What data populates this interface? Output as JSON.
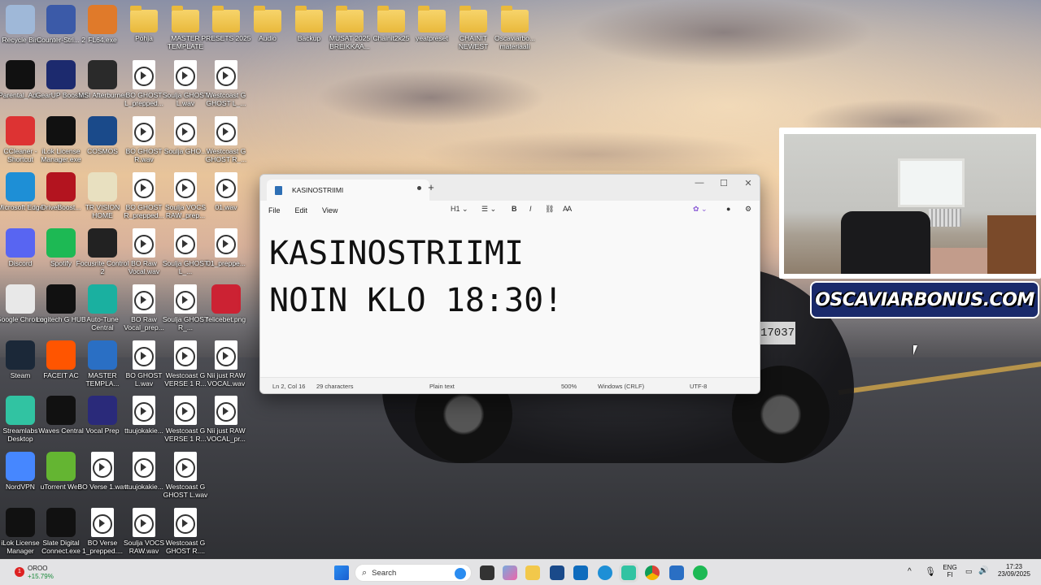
{
  "desktop_icons": [
    {
      "label": "Recycle Bin",
      "icon": "recycle-bin-icon",
      "color": "#9fb8d8"
    },
    {
      "label": "Counter-Stri... 2",
      "icon": "game-icon",
      "color": "#3b5aa8"
    },
    {
      "label": "FL64.exe",
      "icon": "fl-studio-icon",
      "color": "#e07a2a"
    },
    {
      "label": "Pohja",
      "icon": "folder-icon",
      "color": "#f2c84b"
    },
    {
      "label": "MASTER TEMPLATE",
      "icon": "folder-icon",
      "color": "#f2c84b"
    },
    {
      "label": "PRESETS 2025",
      "icon": "folder-icon",
      "color": "#f2c84b"
    },
    {
      "label": "Audio",
      "icon": "folder-icon",
      "color": "#f2c84b"
    },
    {
      "label": "Backup",
      "icon": "folder-icon",
      "color": "#f2c84b"
    },
    {
      "label": "MUSAT 2025 BREIKKAA...",
      "icon": "folder-icon",
      "color": "#f2c84b"
    },
    {
      "label": "Chainit2k25",
      "icon": "folder-icon",
      "color": "#f2c84b"
    },
    {
      "label": "yeatpreset",
      "icon": "folder-icon",
      "color": "#f2c84b"
    },
    {
      "label": "CHAINIT NEWEST",
      "icon": "folder-icon",
      "color": "#f2c84b"
    },
    {
      "label": "Oscaviarbo... materiaali",
      "icon": "folder-icon",
      "color": "#f2c84b"
    },
    {
      "label": "Parental_Ad...",
      "icon": "advisory-image-icon",
      "color": "#111"
    },
    {
      "label": "GearUP Booster",
      "icon": "gearup-icon",
      "color": "#1c2a6e"
    },
    {
      "label": "MSI Afterburner",
      "icon": "msi-icon",
      "color": "#2a2a2a"
    },
    {
      "label": "BO GHOST L_prepped...",
      "icon": "audio-file-icon",
      "color": "#fff"
    },
    {
      "label": "Soulja GHOST L.wav",
      "icon": "audio-file-icon",
      "color": "#fff"
    },
    {
      "label": "Westcoast G GHOST L_...",
      "icon": "audio-file-icon",
      "color": "#fff"
    },
    {
      "label": "CCleaner - Shortcut",
      "icon": "ccleaner-icon",
      "color": "#d33"
    },
    {
      "label": "iLok License Manager.exe",
      "icon": "ilok-icon",
      "color": "#111"
    },
    {
      "label": "COSMOS",
      "icon": "cosmos-icon",
      "color": "#1a4a8a"
    },
    {
      "label": "BO GHOST R.wav",
      "icon": "audio-file-icon",
      "color": "#fff"
    },
    {
      "label": "Soulja GHO...",
      "icon": "audio-file-icon",
      "color": "#fff"
    },
    {
      "label": "Westcoast G GHOST R_...",
      "icon": "audio-file-icon",
      "color": "#fff"
    },
    {
      "label": "Microsoft Edge",
      "icon": "edge-icon",
      "color": "#1e8fd6"
    },
    {
      "label": "DriveBoost...",
      "icon": "driver-booster-icon",
      "color": "#b3141f"
    },
    {
      "label": "TR VISION HOME",
      "icon": "tr-vision-icon",
      "color": "#e8e0c0"
    },
    {
      "label": "BO GHOST R_prepped...",
      "icon": "audio-file-icon",
      "color": "#fff"
    },
    {
      "label": "Soulja VOCS RAW_prep...",
      "icon": "audio-file-icon",
      "color": "#fff"
    },
    {
      "label": "01.wav",
      "icon": "audio-file-icon",
      "color": "#fff"
    },
    {
      "label": "Discord",
      "icon": "discord-icon",
      "color": "#5865f2"
    },
    {
      "label": "Spotify",
      "icon": "spotify-icon",
      "color": "#1db954"
    },
    {
      "label": "Focusrite Control 2",
      "icon": "focusrite-icon",
      "color": "#222"
    },
    {
      "label": "BO Raw Vocal.wav",
      "icon": "audio-file-icon",
      "color": "#fff"
    },
    {
      "label": "Soulja GHOST L_...",
      "icon": "audio-file-icon",
      "color": "#fff"
    },
    {
      "label": "01_preppe...",
      "icon": "audio-file-icon",
      "color": "#fff"
    },
    {
      "label": "Google Chrome",
      "icon": "chrome-icon",
      "color": "#e8e8e8"
    },
    {
      "label": "Logitech G HUB",
      "icon": "logitech-icon",
      "color": "#111"
    },
    {
      "label": "Auto-Tune Central",
      "icon": "autotune-icon",
      "color": "#1ab0a0"
    },
    {
      "label": "BO Raw Vocal_prep...",
      "icon": "audio-file-icon",
      "color": "#fff"
    },
    {
      "label": "Soulja GHOST R_...",
      "icon": "audio-file-icon",
      "color": "#fff"
    },
    {
      "label": "felicebet.png",
      "icon": "image-file-icon",
      "color": "#c23"
    },
    {
      "label": "Steam",
      "icon": "steam-icon",
      "color": "#1b2838"
    },
    {
      "label": "FACEIT AC",
      "icon": "faceit-icon",
      "color": "#ff5500"
    },
    {
      "label": "MASTER TEMPLA...",
      "icon": "project-file-icon",
      "color": "#2a6fc4"
    },
    {
      "label": "BO GHOST L.wav",
      "icon": "audio-file-icon",
      "color": "#fff"
    },
    {
      "label": "Westcoast G VERSE 1 R...",
      "icon": "audio-file-icon",
      "color": "#fff"
    },
    {
      "label": "Nii just RAW VOCAL.wav",
      "icon": "audio-file-icon",
      "color": "#fff"
    },
    {
      "label": "Streamlabs Desktop",
      "icon": "streamlabs-icon",
      "color": "#31c3a2"
    },
    {
      "label": "Waves Central",
      "icon": "waves-icon",
      "color": "#111"
    },
    {
      "label": "Vocal Prep",
      "icon": "vocal-prep-icon",
      "color": "#2a2a7a"
    },
    {
      "label": "ttuujokakie...",
      "icon": "audio-file-icon",
      "color": "#fff"
    },
    {
      "label": "Westcoast G VERSE 1 R...",
      "icon": "audio-file-icon",
      "color": "#fff"
    },
    {
      "label": "Nii just RAW VOCAL_pr...",
      "icon": "audio-file-icon",
      "color": "#fff"
    },
    {
      "label": "NordVPN",
      "icon": "nordvpn-icon",
      "color": "#4687ff"
    },
    {
      "label": "uTorrent Web",
      "icon": "utorrent-icon",
      "color": "#64b532"
    },
    {
      "label": "BO Verse 1.wav",
      "icon": "audio-file-icon",
      "color": "#fff"
    },
    {
      "label": "ttuujokakie...",
      "icon": "audio-file-icon",
      "color": "#fff"
    },
    {
      "label": "Westcoast G GHOST L.wav",
      "icon": "audio-file-icon",
      "color": "#fff"
    },
    {
      "label": "iLok License Manager",
      "icon": "ilok-icon",
      "color": "#111"
    },
    {
      "label": "Slate Digital Connect.exe",
      "icon": "slate-digital-icon",
      "color": "#111"
    },
    {
      "label": "BO Verse 1_prepped....",
      "icon": "audio-file-icon",
      "color": "#fff"
    },
    {
      "label": "Soulja VOCS RAW.wav",
      "icon": "audio-file-icon",
      "color": "#fff"
    },
    {
      "label": "Westcoast G GHOST R....",
      "icon": "audio-file-icon",
      "color": "#fff"
    }
  ],
  "notepad": {
    "tab_title": "KASINOSTRIIMI",
    "new_tab": "+",
    "menu": {
      "file": "File",
      "edit": "Edit",
      "view": "View"
    },
    "toolbar": {
      "heading": "H1",
      "bold": "B",
      "italic": "I"
    },
    "content_line1": "KASINOSTRIIMI",
    "content_line2": "NOIN KLO 18:30!",
    "status": {
      "position": "Ln 2, Col 16",
      "chars": "29 characters",
      "format": "Plain text",
      "zoom": "500%",
      "line_ending": "Windows (CRLF)",
      "encoding": "UTF-8"
    }
  },
  "overlay": {
    "promo_text": "OSCAVIARBONUS.COM"
  },
  "scene": {
    "plate_text": "17037"
  },
  "taskbar": {
    "stock_name": "OROO",
    "stock_change": "+15.79%",
    "notification_count": "1",
    "search_placeholder": "Search",
    "language": "ENG",
    "region": "FI",
    "time": "17:23",
    "date": "23/09/2025"
  }
}
